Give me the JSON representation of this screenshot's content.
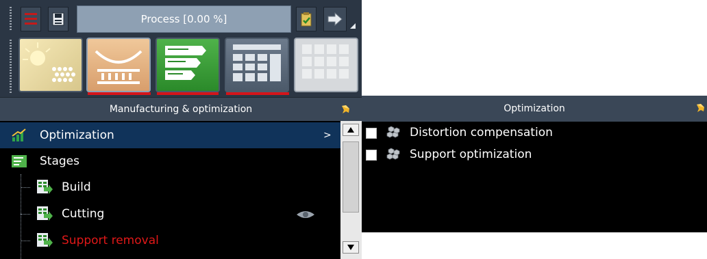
{
  "toolbar": {
    "progress_label": "Process [0.00 %]",
    "buttons": [
      {
        "icon": "menu-icon"
      },
      {
        "icon": "save-icon"
      },
      {
        "icon": "clipboard-check-icon"
      },
      {
        "icon": "arrow-right-icon"
      }
    ]
  },
  "process_steps": [
    {
      "icon": "light-exposure-icon",
      "active": false
    },
    {
      "icon": "build-platform-icon",
      "active": true
    },
    {
      "icon": "stages-icon",
      "active": true
    },
    {
      "icon": "calculator-icon",
      "active": true
    },
    {
      "icon": "grid-disabled-icon",
      "active": false
    }
  ],
  "left_panel": {
    "title": "Manufacturing & optimization",
    "items": [
      {
        "label": "Optimization",
        "expand_marker": ">",
        "selected": true
      },
      {
        "label": "Stages"
      },
      {
        "label": "Build"
      },
      {
        "label": "Cutting"
      },
      {
        "label": "Support removal"
      }
    ]
  },
  "right_panel": {
    "title": "Optimization",
    "items": [
      {
        "label": "Distortion compensation",
        "checked": false
      },
      {
        "label": "Support optimization",
        "checked": false
      }
    ]
  },
  "colors": {
    "panel_bg": "#2b3644",
    "header_bg": "#3a4757",
    "selection_bg": "#10335a",
    "error_text": "#e01818",
    "accent_underline": "#d4141a"
  }
}
